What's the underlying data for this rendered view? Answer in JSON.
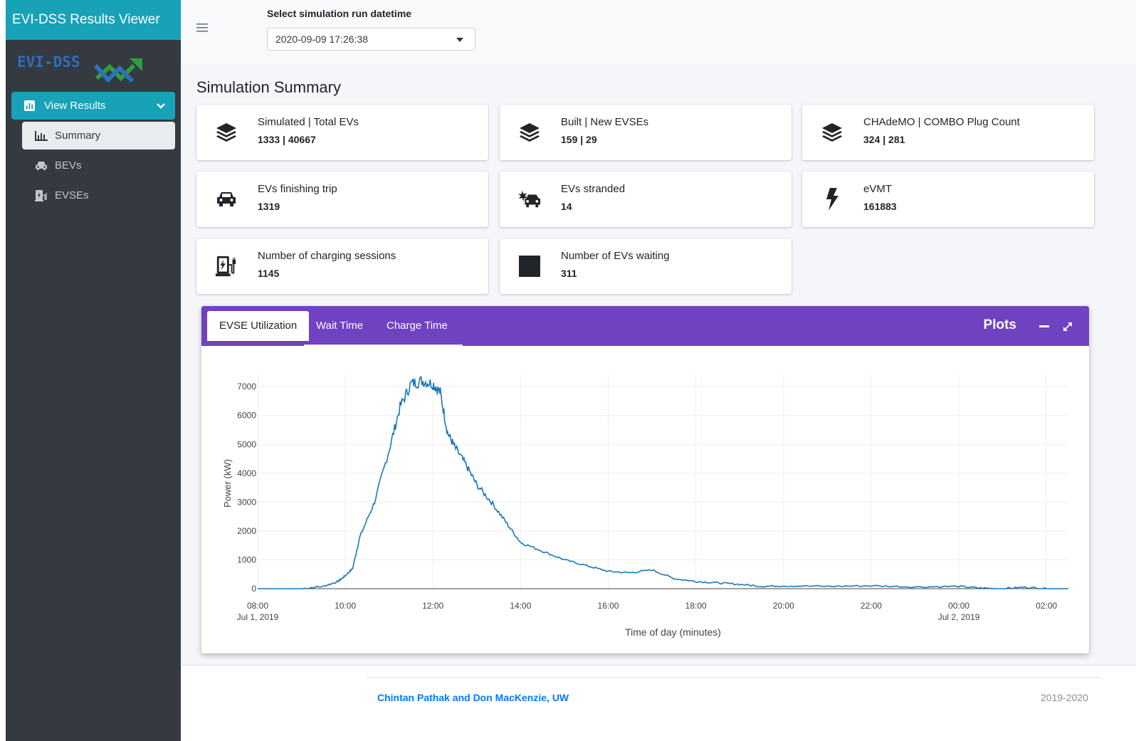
{
  "app": {
    "title": "EVI-DSS Results Viewer",
    "logo_text": "EVI-DSS"
  },
  "sidebar": {
    "main_item": {
      "label": "View Results",
      "icon": "chart-bar-icon"
    },
    "items": [
      {
        "label": "Summary",
        "icon": "chart-bar-outline-icon",
        "active": true
      },
      {
        "label": "BEVs",
        "icon": "car-icon",
        "active": false
      },
      {
        "label": "EVSEs",
        "icon": "charging-station-icon",
        "active": false
      }
    ]
  },
  "header": {
    "select_label": "Select simulation run datetime",
    "select_value": "2020-09-09 17:26:38"
  },
  "page_title": "Simulation Summary",
  "info_boxes": [
    {
      "title": "Simulated | Total EVs",
      "value": "1333 | 40667",
      "icon": "layer-group-icon"
    },
    {
      "title": "Built | New EVSEs",
      "value": "159 | 29",
      "icon": "layer-group-icon"
    },
    {
      "title": "CHAdeMO | COMBO Plug Count",
      "value": "324 | 281",
      "icon": "layer-group-icon"
    },
    {
      "title": "EVs finishing trip",
      "value": "1319",
      "icon": "car-icon"
    },
    {
      "title": "EVs stranded",
      "value": "14",
      "icon": "car-crash-icon"
    },
    {
      "title": "eVMT",
      "value": "161883",
      "icon": "bolt-icon"
    },
    {
      "title": "Number of charging sessions",
      "value": "1145",
      "icon": "charging-station-icon"
    },
    {
      "title": "Number of EVs waiting",
      "value": "311",
      "icon": "square-icon"
    }
  ],
  "plots": {
    "title": "Plots",
    "tabs": [
      "EVSE Utilization",
      "Wait Time",
      "Charge Time"
    ],
    "active_tab": 0,
    "collapse_icon": "minus-icon",
    "expand_icon": "expand-icon"
  },
  "chart_data": {
    "type": "line",
    "xlabel": "Time of day (minutes)",
    "ylabel": "Power (kW)",
    "x_ticks": [
      "08:00",
      "10:00",
      "12:00",
      "14:00",
      "16:00",
      "18:00",
      "20:00",
      "22:00",
      "00:00",
      "02:00"
    ],
    "x_tick_dates": {
      "08:00": "Jul 1, 2019",
      "00:00": "Jul 2, 2019"
    },
    "xlim": [
      "2019-07-01 08:00",
      "2019-07-02 02:30"
    ],
    "y_ticks": [
      0,
      1000,
      2000,
      3000,
      4000,
      5000,
      6000,
      7000
    ],
    "ylim": [
      0,
      7300
    ],
    "grid": true,
    "series_color": "#1f77b4",
    "series": [
      {
        "name": "",
        "x": [
          "2019-07-01 08:00",
          "2019-07-01 09:00",
          "2019-07-01 09:30",
          "2019-07-01 09:50",
          "2019-07-01 10:00",
          "2019-07-01 10:10",
          "2019-07-01 10:20",
          "2019-07-01 10:40",
          "2019-07-01 11:00",
          "2019-07-01 11:15",
          "2019-07-01 11:30",
          "2019-07-01 11:45",
          "2019-07-01 12:00",
          "2019-07-01 12:10",
          "2019-07-01 12:20",
          "2019-07-01 12:30",
          "2019-07-01 12:45",
          "2019-07-01 13:00",
          "2019-07-01 13:20",
          "2019-07-01 13:40",
          "2019-07-01 14:00",
          "2019-07-01 14:30",
          "2019-07-01 15:00",
          "2019-07-01 15:30",
          "2019-07-01 16:00",
          "2019-07-01 16:30",
          "2019-07-01 17:00",
          "2019-07-01 17:30",
          "2019-07-01 18:00",
          "2019-07-01 18:30",
          "2019-07-01 19:00",
          "2019-07-01 19:30",
          "2019-07-01 20:00",
          "2019-07-01 21:00",
          "2019-07-01 22:00",
          "2019-07-01 23:00",
          "2019-07-02 00:00",
          "2019-07-02 00:30",
          "2019-07-02 01:00",
          "2019-07-02 01:30",
          "2019-07-02 02:00",
          "2019-07-02 02:30"
        ],
        "y": [
          0,
          0,
          80,
          250,
          450,
          700,
          1800,
          3000,
          4800,
          6300,
          7100,
          7200,
          7100,
          6800,
          5400,
          4900,
          4300,
          3600,
          3000,
          2300,
          1600,
          1300,
          1000,
          800,
          600,
          550,
          650,
          350,
          250,
          200,
          150,
          80,
          100,
          80,
          100,
          60,
          80,
          20,
          0,
          50,
          0,
          0
        ]
      }
    ]
  },
  "footer": {
    "credits": "Chintan Pathak and Don MacKenzie, UW",
    "years": "2019-2020"
  }
}
